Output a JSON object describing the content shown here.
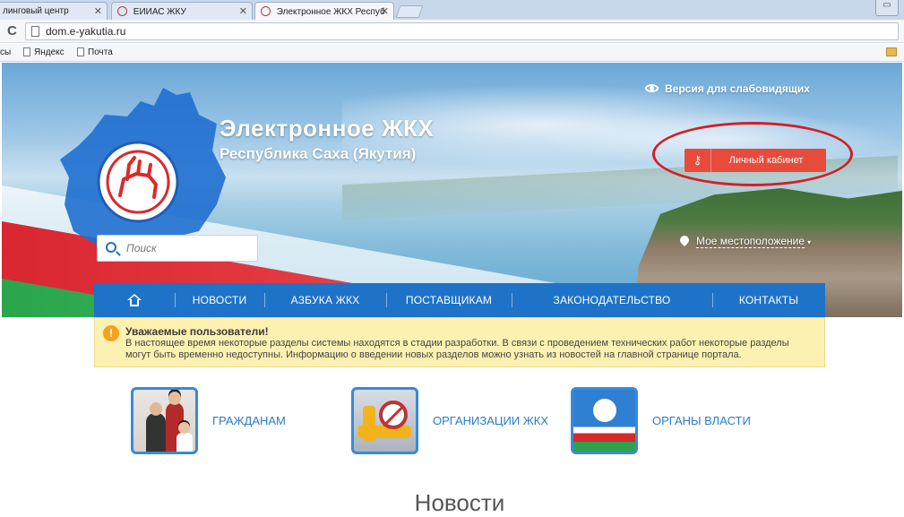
{
  "browser": {
    "tabs": [
      {
        "label": "линговый центр",
        "active": false
      },
      {
        "label": "ЕИИАС ЖКУ",
        "active": false
      },
      {
        "label": "Электронное ЖКХ Респуб",
        "active": true
      }
    ],
    "url": "dom.e-yakutia.ru",
    "bookmarks": [
      "сы",
      "Яндекс",
      "Почта"
    ]
  },
  "header": {
    "title": "Электронное ЖКХ",
    "subtitle": "Республика Саха (Якутия)",
    "accessibility_link": "Версия для слабовидящих",
    "cabinet_button": "Личный кабинет",
    "search_placeholder": "Поиск",
    "location_label": "Мое местоположение",
    "location_caret": "▾"
  },
  "nav": {
    "items": [
      "НОВОСТИ",
      "АЗБУКА ЖКХ",
      "ПОСТАВЩИКАМ",
      "ЗАКОНОДАТЕЛЬСТВО",
      "КОНТАКТЫ"
    ]
  },
  "notice": {
    "icon": "!",
    "title": "Уважаемые пользователи!",
    "text": "В настоящее время некоторые разделы системы находятся в стадии разработки. В связи с проведением технических работ некоторые разделы могут быть временно недоступны. Информацию о введении новых разделов можно узнать из новостей на главной странице портала."
  },
  "cards": [
    {
      "label": "ГРАЖДАНАМ"
    },
    {
      "label": "ОРГАНИЗАЦИИ ЖКХ"
    },
    {
      "label": "ОРГАНЫ ВЛАСТИ"
    }
  ],
  "news": {
    "heading": "Новости"
  },
  "colors": {
    "nav_blue": "#1e73c8",
    "cabinet_red": "#e64b3c",
    "notice_bg": "#fdf1b2",
    "link_blue": "#2c7ac9"
  }
}
